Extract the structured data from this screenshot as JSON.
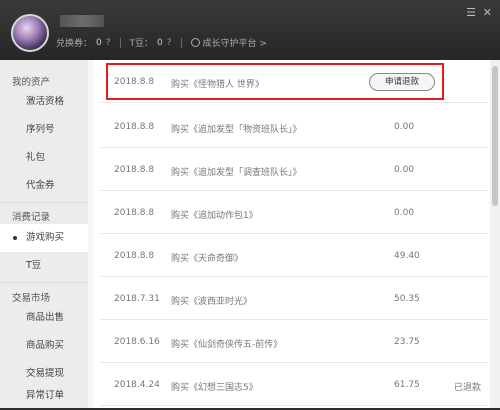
{
  "header": {
    "exchange_label": "兑换券：",
    "exchange_value": "0",
    "tbean_label": "T豆：",
    "tbean_value": "0",
    "growth_link": "成长守护平台 >",
    "menu_icon": "menu-icon",
    "close_icon": "close-icon"
  },
  "sidebar": {
    "groups": [
      {
        "label": "我的资产"
      },
      {
        "label": "消费记录"
      },
      {
        "label": "交易市场"
      }
    ],
    "items": [
      {
        "label": "激活资格"
      },
      {
        "label": "序列号"
      },
      {
        "label": "礼包"
      },
      {
        "label": "代金券"
      },
      {
        "label": "游戏购买"
      },
      {
        "label": "T豆"
      },
      {
        "label": "商品出售"
      },
      {
        "label": "商品购买"
      },
      {
        "label": "交易提现"
      },
      {
        "label": "异常订单"
      }
    ]
  },
  "records": [
    {
      "date": "2018.8.8",
      "desc": "购买《怪物猎人 世界》",
      "amount": "",
      "status": "",
      "action": "申请退款"
    },
    {
      "date": "2018.8.8",
      "desc": "购买《追加发型「物资班队长」》",
      "amount": "0.00",
      "status": "",
      "action": ""
    },
    {
      "date": "2018.8.8",
      "desc": "购买《追加发型「调查班队长」》",
      "amount": "0.00",
      "status": "",
      "action": ""
    },
    {
      "date": "2018.8.8",
      "desc": "购买《追加动作包1》",
      "amount": "0.00",
      "status": "",
      "action": ""
    },
    {
      "date": "2018.8.8",
      "desc": "购买《天命奇御》",
      "amount": "49.40",
      "status": "",
      "action": ""
    },
    {
      "date": "2018.7.31",
      "desc": "购买《波西亚时光》",
      "amount": "50.35",
      "status": "",
      "action": ""
    },
    {
      "date": "2018.6.16",
      "desc": "购买《仙剑奇侠传五-前传》",
      "amount": "23.75",
      "status": "",
      "action": ""
    },
    {
      "date": "2018.4.24",
      "desc": "购买《幻想三国志5》",
      "amount": "61.75",
      "status": "已退款",
      "action": ""
    }
  ]
}
